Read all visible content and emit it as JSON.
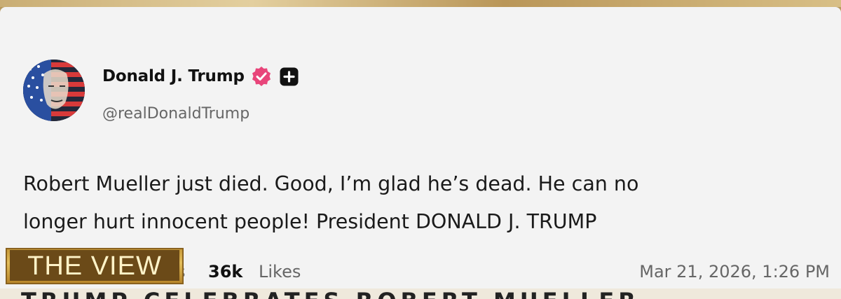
{
  "post": {
    "author": {
      "display_name": "Donald J. Trump",
      "handle": "@realDonaldTrump",
      "avatar_icon": "flag-portrait-avatar",
      "verified_icon": "verified-badge-icon",
      "verified_color": "#e8457a",
      "plus_icon": "plus-square-icon"
    },
    "body_lines": [
      "Robert Mueller just died. Good, I’m glad he’s dead. He can no",
      "longer hurt innocent people! President DONALD J. TRUMP"
    ],
    "stats": {
      "partial_label": "s",
      "likes_count": "36k",
      "likes_label": "Likes"
    },
    "timestamp": "Mar 21, 2026, 1:26 PM"
  },
  "overlay": {
    "show_bug": "THE VIEW",
    "bug_color": "#6b4a18",
    "ticker_text": "TRUMP CELEBRATES ROBERT MUELLER"
  }
}
